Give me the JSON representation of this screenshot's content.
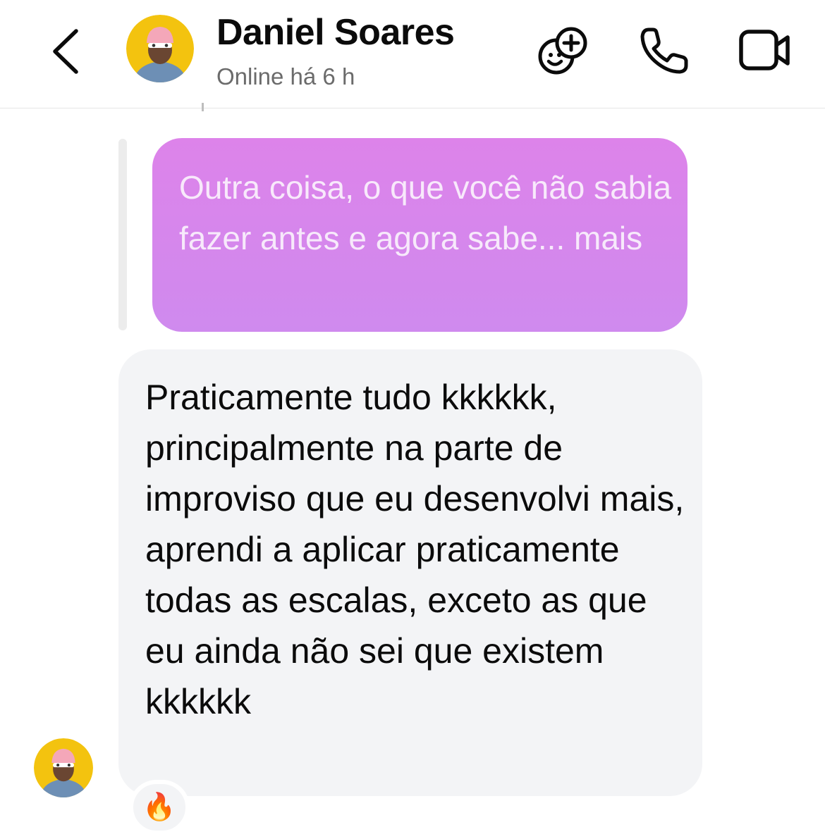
{
  "header": {
    "name": "Daniel Soares",
    "status": "Online há 6 h"
  },
  "icons": {
    "back": "chevron-left-icon",
    "effects": "add-effects-icon",
    "call": "phone-icon",
    "video": "video-camera-icon",
    "reaction": "fire-icon"
  },
  "messages": {
    "sent": {
      "text": "Outra coisa, o que você não sabia fazer antes e agora sabe...",
      "more": "mais"
    },
    "received": {
      "text": "Praticamente tudo kkkkkk, principalmente na parte de improviso que eu desenvolvi mais, aprendi a aplicar praticamente todas as escalas, exceto as que eu ainda não sei que existem kkkkkk",
      "reaction": "🔥"
    }
  },
  "colors": {
    "sent_bubble_top": "#dd83ea",
    "sent_bubble_bottom": "#cf8aee",
    "received_bubble": "#f3f4f6",
    "avatar_bg": "#f3c30f"
  }
}
